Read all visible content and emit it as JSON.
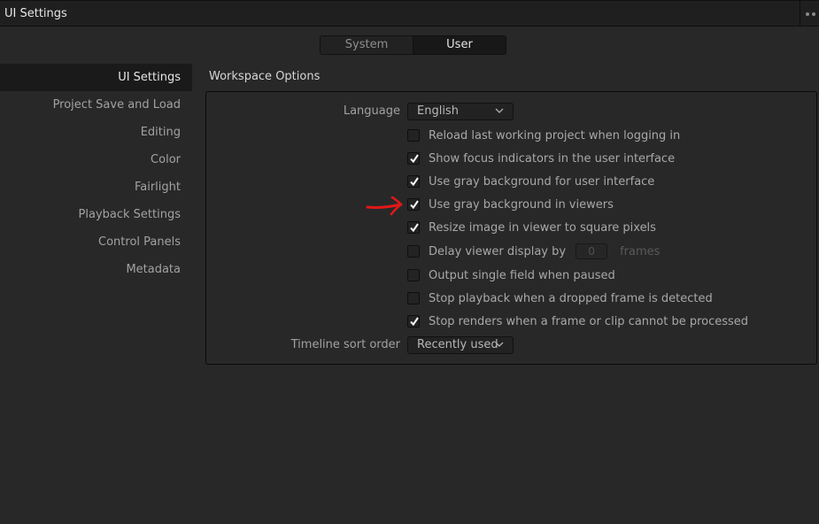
{
  "window": {
    "title": "UI Settings",
    "more_icon": "more-dots-icon"
  },
  "tabs": [
    {
      "label": "System",
      "active": false
    },
    {
      "label": "User",
      "active": true
    }
  ],
  "sidebar": {
    "items": [
      {
        "label": "UI Settings",
        "active": true
      },
      {
        "label": "Project Save and Load",
        "active": false
      },
      {
        "label": "Editing",
        "active": false
      },
      {
        "label": "Color",
        "active": false
      },
      {
        "label": "Fairlight",
        "active": false
      },
      {
        "label": "Playback Settings",
        "active": false
      },
      {
        "label": "Control Panels",
        "active": false
      },
      {
        "label": "Metadata",
        "active": false
      }
    ]
  },
  "workspace": {
    "title": "Workspace Options",
    "language_label": "Language",
    "language_value": "English",
    "options": [
      {
        "label": "Reload last working project when logging in",
        "checked": false
      },
      {
        "label": "Show focus indicators in the user interface",
        "checked": true
      },
      {
        "label": "Use gray background for user interface",
        "checked": true
      },
      {
        "label": "Use gray background in viewers",
        "checked": true
      },
      {
        "label": "Resize image in viewer to square pixels",
        "checked": true
      },
      {
        "label": "Delay viewer display by",
        "checked": false
      },
      {
        "label": "Output single field when paused",
        "checked": false
      },
      {
        "label": "Stop playback when a dropped frame is detected",
        "checked": false
      },
      {
        "label": "Stop renders when a frame or clip cannot be processed",
        "checked": true
      }
    ],
    "delay_value": "0",
    "delay_unit": "frames",
    "sort_label": "Timeline sort order",
    "sort_value": "Recently used"
  },
  "annotation": {
    "type": "red-arrow",
    "color": "#e01818",
    "points_to": "Use gray background in viewers"
  },
  "colors": {
    "background": "#282828",
    "titlebar": "#1f1f1f",
    "active_item": "#1a1a1a",
    "text": "#a8a8a8",
    "text_active": "#e6e6e6"
  }
}
